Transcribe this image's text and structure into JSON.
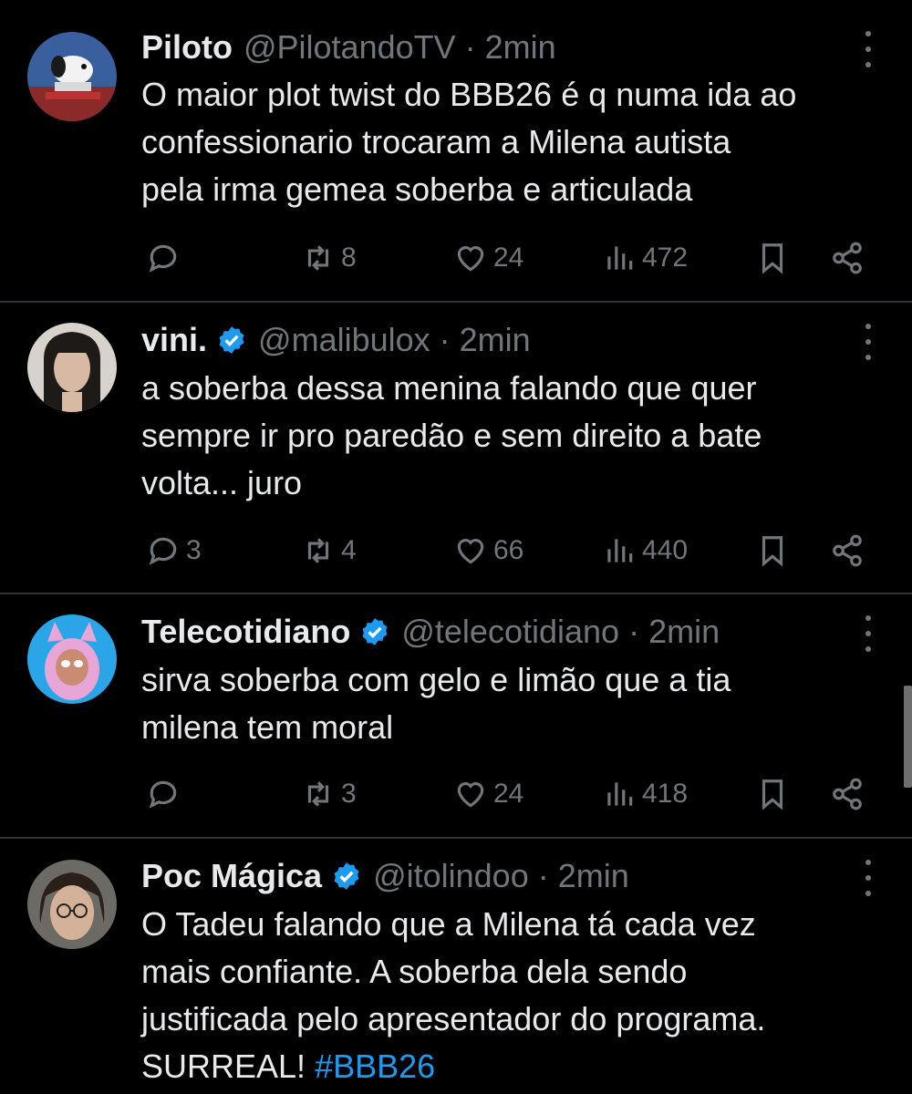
{
  "tweets": [
    {
      "name": "Piloto",
      "verified": false,
      "handle": "@PilotandoTV",
      "separator": "·",
      "time": "2min",
      "text": "O maior plot twist do BBB26 é q numa ida ao\nconfessionario trocaram a Milena autista\npela irma gemea soberba e articulada",
      "replies": "",
      "reposts": "8",
      "likes": "24",
      "views": "472"
    },
    {
      "name": "vini.",
      "verified": true,
      "handle": "@malibulox",
      "separator": "·",
      "time": "2min",
      "text": "a soberba dessa menina falando que quer\nsempre ir pro paredão e sem direito a bate\nvolta... juro",
      "replies": "3",
      "reposts": "4",
      "likes": "66",
      "views": "440"
    },
    {
      "name": "Telecotidiano",
      "verified": true,
      "handle": "@telecotidiano",
      "separator": "·",
      "time": "2min",
      "text": "sirva soberba com gelo e limão que a tia\nmilena tem moral",
      "replies": "",
      "reposts": "3",
      "likes": "24",
      "views": "418"
    },
    {
      "name": "Poc Mágica",
      "verified": true,
      "handle": "@itolindoo",
      "separator": "·",
      "time": "2min",
      "text_main": "O Tadeu falando que a Milena tá cada vez\nmais confiante. A soberba dela sendo\njustificada pelo apresentador do programa.\nSURREAL! ",
      "hashtag": "#BBB26"
    }
  ],
  "colors": {
    "background": "#000000",
    "text_primary": "#e7e9ea",
    "text_secondary": "#71767b",
    "accent": "#1d9bf0",
    "divider": "#2f3336"
  },
  "icons": {
    "reply": "reply-icon",
    "repost": "repost-icon",
    "like": "heart-icon",
    "views": "views-icon",
    "bookmark": "bookmark-icon",
    "share": "share-icon",
    "more": "more-vertical-icon",
    "verified": "verified-badge-icon"
  }
}
